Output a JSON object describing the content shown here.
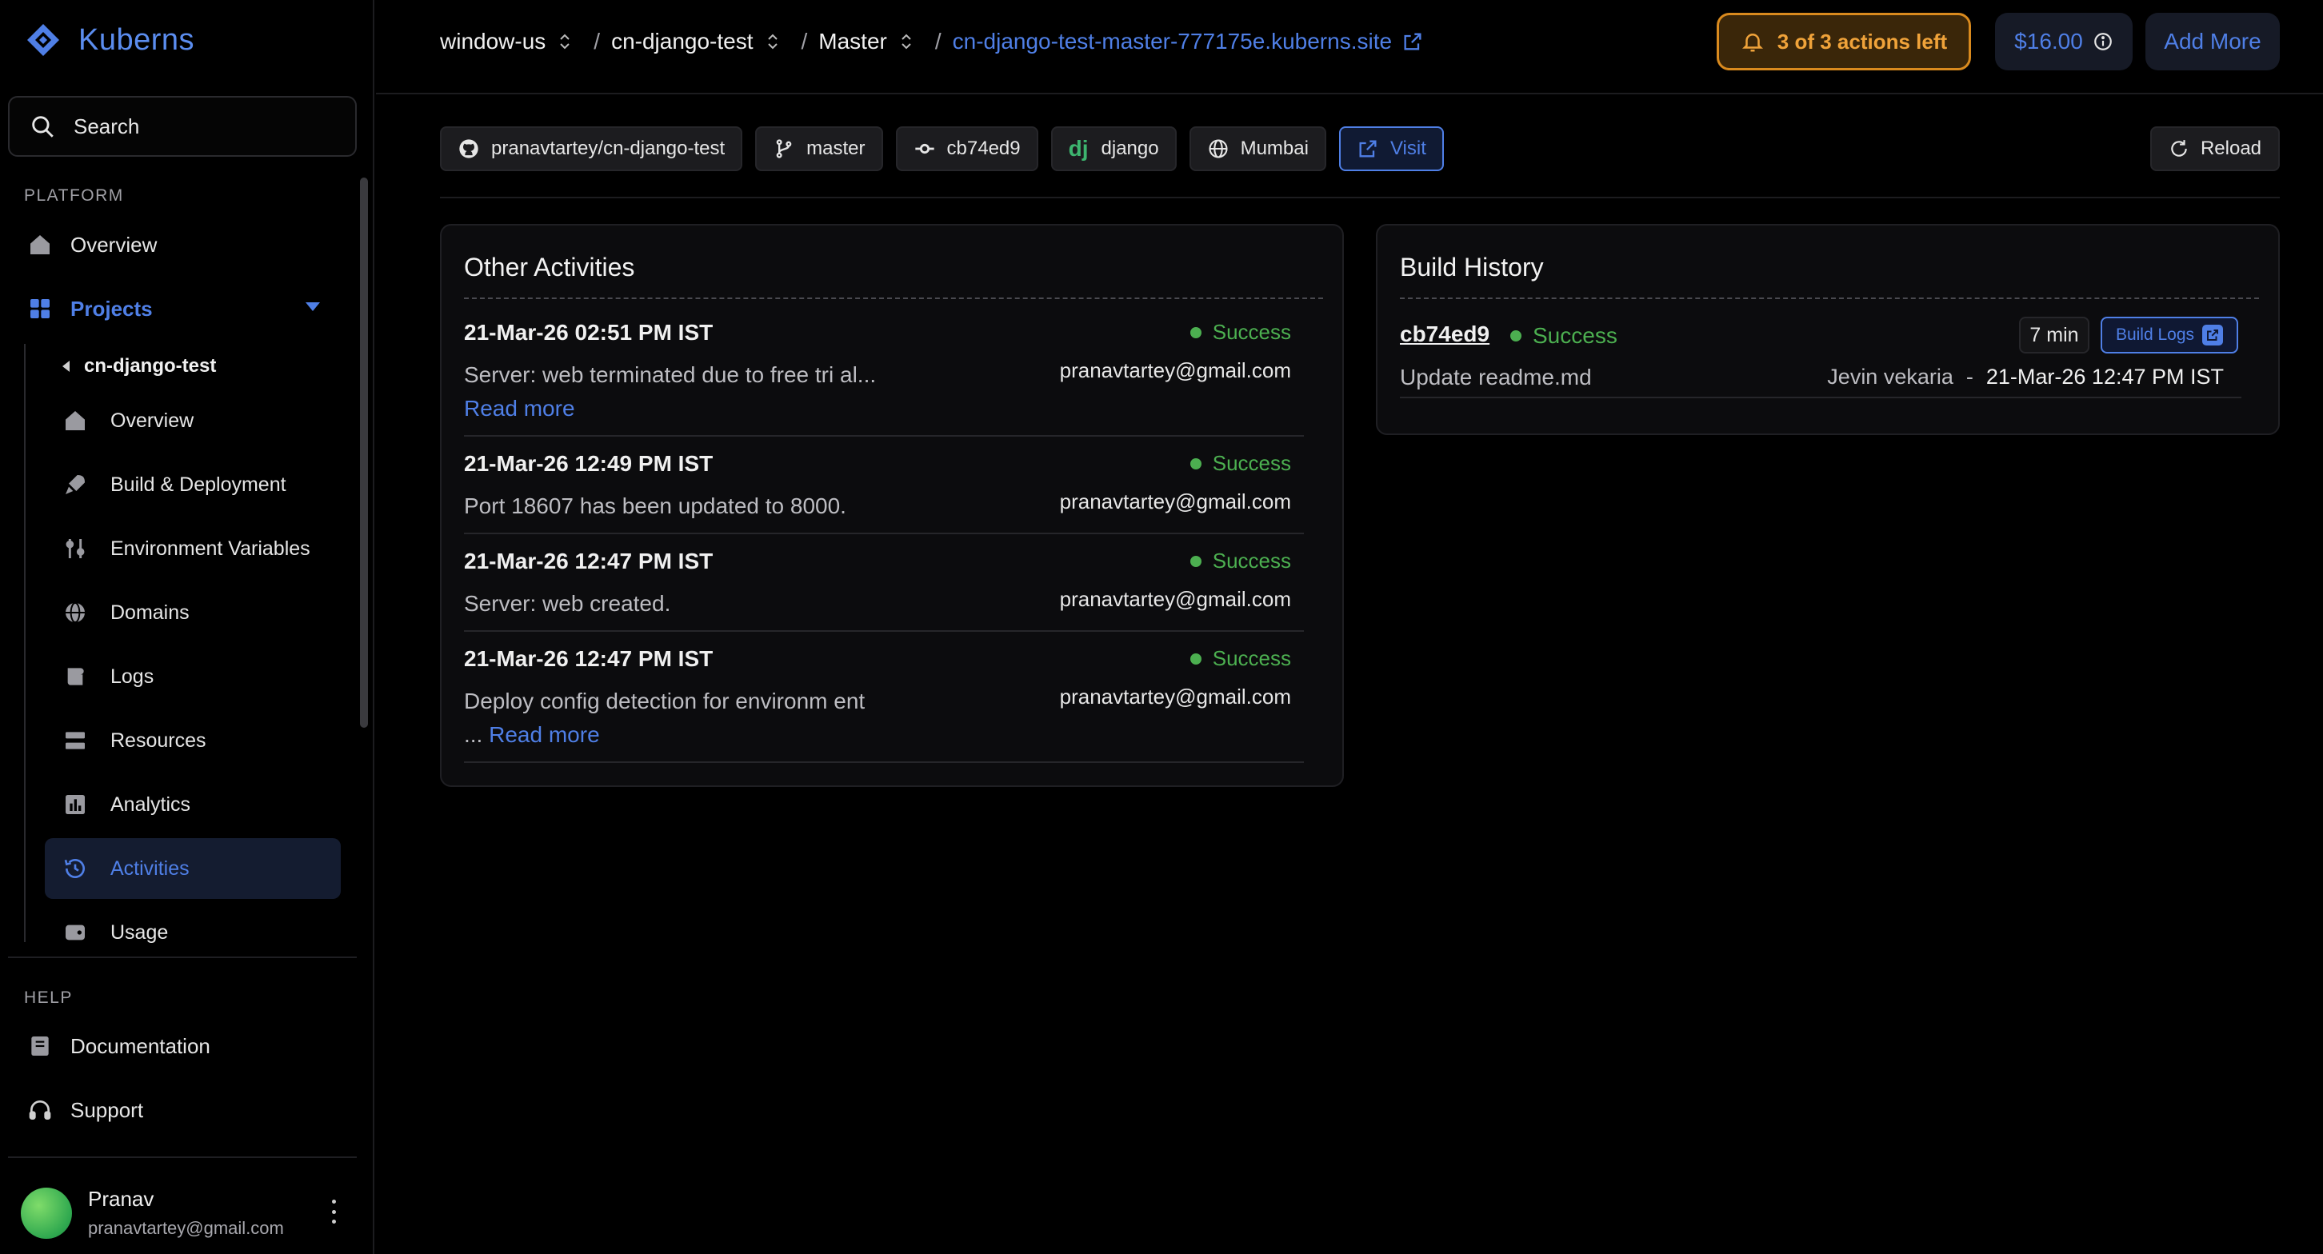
{
  "app": {
    "name": "Kuberns"
  },
  "sidebar": {
    "search_label": "Search",
    "platform_title": "PLATFORM",
    "overview": "Overview",
    "projects": "Projects",
    "project_name": "cn-django-test",
    "sub_items": [
      {
        "label": "Overview",
        "icon": "home-icon"
      },
      {
        "label": "Build & Deployment",
        "icon": "rocket-icon"
      },
      {
        "label": "Environment Variables",
        "icon": "sliders-icon"
      },
      {
        "label": "Domains",
        "icon": "globe-icon"
      },
      {
        "label": "Logs",
        "icon": "logs-icon"
      },
      {
        "label": "Resources",
        "icon": "server-icon"
      },
      {
        "label": "Analytics",
        "icon": "chart-icon"
      },
      {
        "label": "Activities",
        "icon": "history-icon"
      },
      {
        "label": "Usage",
        "icon": "wallet-icon"
      }
    ],
    "help_title": "HELP",
    "documentation": "Documentation",
    "support": "Support",
    "user": {
      "name": "Pranav",
      "email": "pranavtartey@gmail.com"
    }
  },
  "topbar": {
    "breadcrumb": [
      "window-us",
      "cn-django-test",
      "Master"
    ],
    "site_link": "cn-django-test-master-777175e.kuberns.site",
    "actions_left": "3 of 3 actions left",
    "credit": "$16.00",
    "add_more": "Add More"
  },
  "chips": {
    "repo": "pranavtartey/cn-django-test",
    "branch": "master",
    "commit": "cb74ed9",
    "framework": "django",
    "framework_badge": "dj",
    "region": "Mumbai",
    "visit": "Visit",
    "reload": "Reload"
  },
  "activities": {
    "title": "Other Activities",
    "items": [
      {
        "date": "21-Mar-26 02:51 PM IST",
        "text": "Server: web terminated due to free tri al...",
        "more": "Read more",
        "status": "Success",
        "email": "pranavtartey@gmail.com"
      },
      {
        "date": "21-Mar-26 12:49 PM IST",
        "text": "Port 18607 has been updated to 8000.",
        "more": "",
        "status": "Success",
        "email": "pranavtartey@gmail.com"
      },
      {
        "date": "21-Mar-26 12:47 PM IST",
        "text": "Server: web created.",
        "more": "",
        "status": "Success",
        "email": "pranavtartey@gmail.com"
      },
      {
        "date": "21-Mar-26 12:47 PM IST",
        "text": "Deploy config detection for environm ent ...",
        "more": "Read more",
        "status": "Success",
        "email": "pranavtartey@gmail.com"
      }
    ]
  },
  "build_history": {
    "title": "Build History",
    "items": [
      {
        "commit": "cb74ed9",
        "status": "Success",
        "duration": "7 min",
        "logs_label": "Build Logs",
        "message": "Update readme.md",
        "author": "Jevin vekaria",
        "separator": "-",
        "when": "21-Mar-26 12:47 PM IST"
      }
    ]
  },
  "colors": {
    "accent": "#4f7fe6",
    "success": "#4caf50",
    "warning": "#d98a1e"
  }
}
